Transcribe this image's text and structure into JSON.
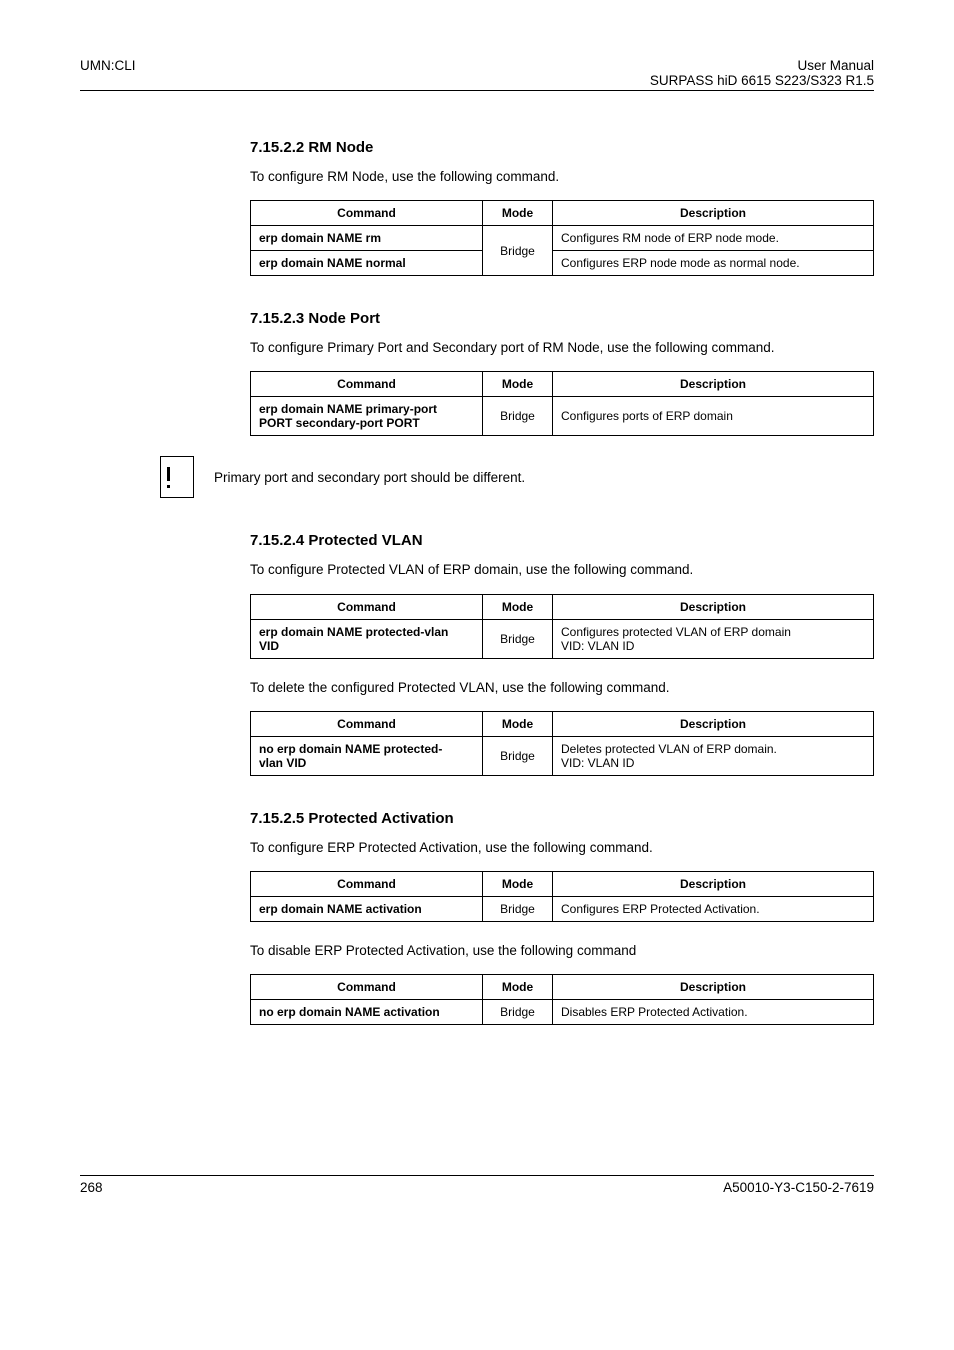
{
  "header": {
    "left": "UMN:CLI",
    "right_line1": "User Manual",
    "right_line2": "SURPASS hiD 6615 S223/S323 R1.5"
  },
  "sections": {
    "rm_node": {
      "title": "7.15.2.2  RM Node",
      "intro": "To configure RM Node, use the following command.",
      "th": {
        "c": "Command",
        "m": "Mode",
        "d": "Description"
      },
      "rows": {
        "r0": {
          "c": "erp domain NAME rm",
          "d": "Configures RM node of ERP node mode."
        },
        "r1": {
          "c": "erp domain NAME normal",
          "d": "Configures ERP node mode as normal node."
        },
        "mode": "Bridge"
      }
    },
    "node_port": {
      "title": "7.15.2.3  Node Port",
      "intro": "To configure Primary Port and Secondary port of RM Node, use the following command.",
      "th": {
        "c": "Command",
        "m": "Mode",
        "d": "Description"
      },
      "row": {
        "c1": "erp domain NAME primary-port",
        "c2": "PORT secondary-port PORT",
        "m": "Bridge",
        "d": "Configures ports of ERP domain"
      },
      "note": "Primary port and secondary port should be different."
    },
    "protected_vlan": {
      "title": "7.15.2.4  Protected VLAN",
      "intro": "To configure Protected VLAN of ERP domain, use the following command.",
      "th": {
        "c": "Command",
        "m": "Mode",
        "d": "Description"
      },
      "row1": {
        "c1": "erp domain NAME protected-vlan",
        "c2": "VID",
        "m": "Bridge",
        "d1": "Configures protected VLAN of ERP domain",
        "d2": "VID: VLAN ID"
      },
      "intro2": "To delete the configured Protected VLAN, use the following command.",
      "row2": {
        "c1": "no erp domain NAME protected-",
        "c2": "vlan VID",
        "m": "Bridge",
        "d1": "Deletes protected VLAN of ERP domain.",
        "d2": "VID: VLAN ID"
      }
    },
    "protected_activation": {
      "title": "7.15.2.5  Protected Activation",
      "intro": "To configure ERP Protected Activation, use the following command.",
      "th": {
        "c": "Command",
        "m": "Mode",
        "d": "Description"
      },
      "row1": {
        "c": "erp domain NAME activation",
        "m": "Bridge",
        "d": "Configures ERP Protected Activation."
      },
      "intro2": "To disable ERP Protected Activation, use the following command",
      "row2": {
        "c": "no erp domain NAME activation",
        "m": "Bridge",
        "d": "Disables ERP Protected Activation."
      }
    }
  },
  "footer": {
    "left": "268",
    "right": "A50010-Y3-C150-2-7619"
  }
}
